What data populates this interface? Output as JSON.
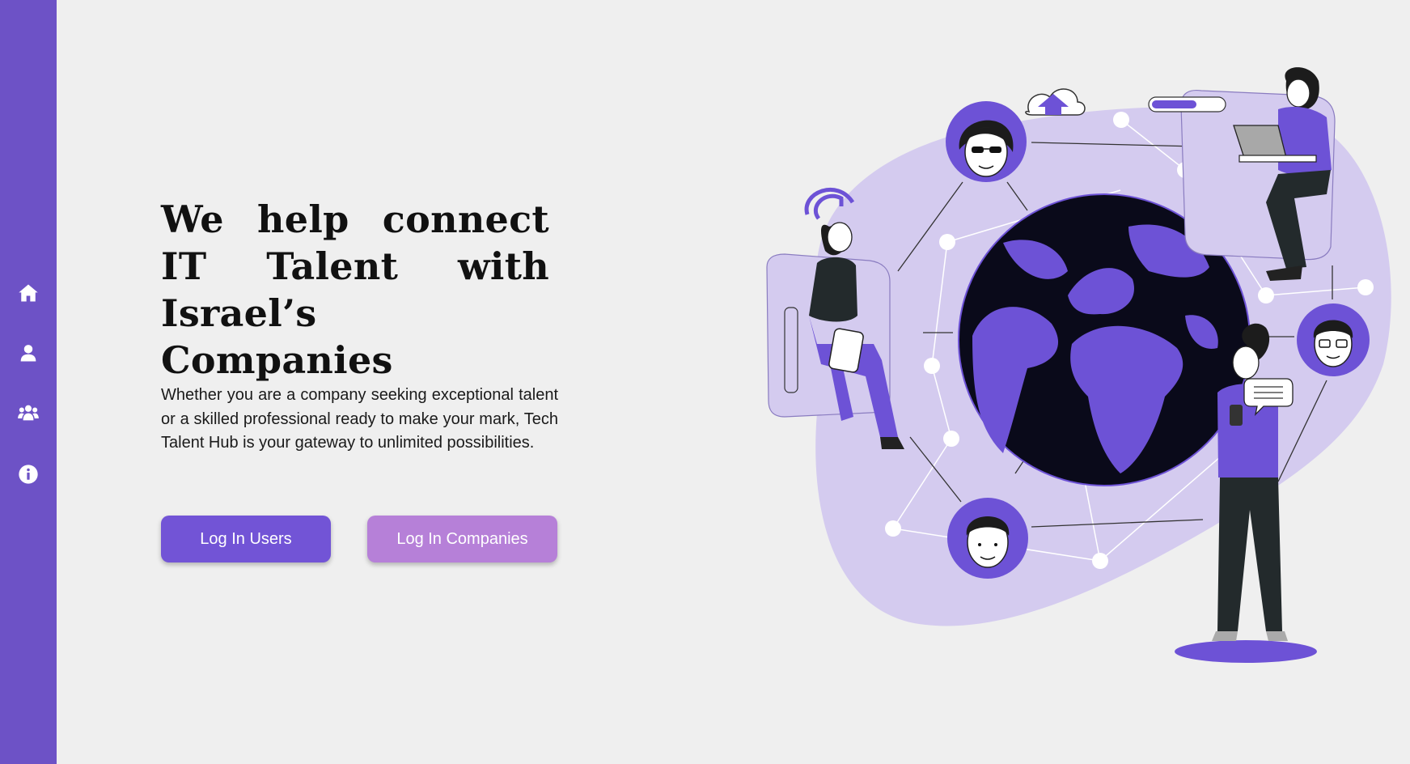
{
  "nav": {
    "items": [
      {
        "name": "home",
        "icon": "home-icon"
      },
      {
        "name": "profile",
        "icon": "user-icon"
      },
      {
        "name": "community",
        "icon": "users-icon"
      },
      {
        "name": "about",
        "icon": "info-icon"
      }
    ]
  },
  "hero": {
    "title": "We help connect IT Talent with Israel’s Companies",
    "description": "Whether you are a company seeking exceptional talent or a skilled professional ready to make your mark, Tech Talent Hub is your gateway to unlimited possibilities.",
    "login_users_label": "Log In Users",
    "login_companies_label": "Log In Companies"
  },
  "colors": {
    "sidebar": "#6d52c6",
    "primary_button": "#7254d6",
    "secondary_button": "#b680d8",
    "blob": "#d4cbef",
    "globe": "#0a0a1a",
    "accent": "#6d52d6"
  }
}
